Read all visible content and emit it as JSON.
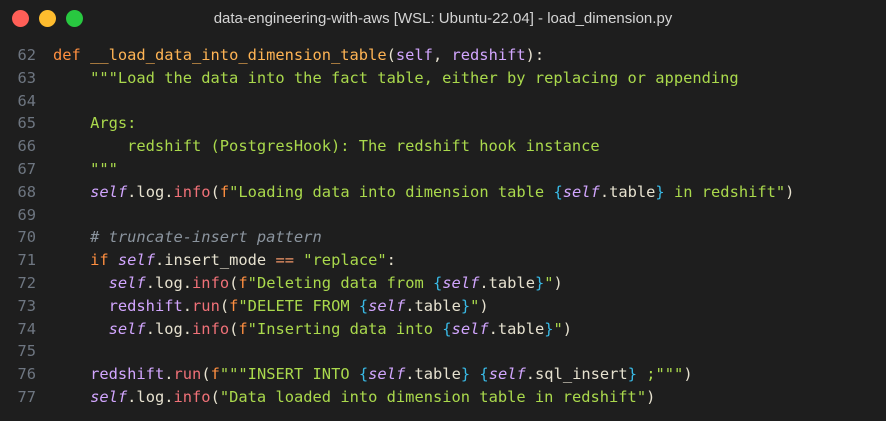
{
  "window": {
    "title": "data-engineering-with-aws [WSL: Ubuntu-22.04] - load_dimension.py"
  },
  "editor": {
    "lines": [
      {
        "num": "62",
        "tokens": [
          {
            "t": "def ",
            "c": "kw"
          },
          {
            "t": "__load_data_into_dimension_table",
            "c": "fn"
          },
          {
            "t": "(",
            "c": "plain"
          },
          {
            "t": "self",
            "c": "param"
          },
          {
            "t": ", ",
            "c": "plain"
          },
          {
            "t": "redshift",
            "c": "param"
          },
          {
            "t": "):",
            "c": "plain"
          }
        ]
      },
      {
        "num": "63",
        "tokens": [
          {
            "t": "    \"\"\"Load the data into the fact table, either by replacing or appending",
            "c": "str"
          }
        ]
      },
      {
        "num": "64",
        "tokens": []
      },
      {
        "num": "65",
        "tokens": [
          {
            "t": "    Args:",
            "c": "str"
          }
        ]
      },
      {
        "num": "66",
        "tokens": [
          {
            "t": "        redshift (PostgresHook): The redshift hook instance",
            "c": "str"
          }
        ]
      },
      {
        "num": "67",
        "tokens": [
          {
            "t": "    \"\"\"",
            "c": "str"
          }
        ]
      },
      {
        "num": "68",
        "tokens": [
          {
            "t": "    ",
            "c": "plain"
          },
          {
            "t": "self",
            "c": "self"
          },
          {
            "t": ".log.",
            "c": "plain"
          },
          {
            "t": "info",
            "c": "call"
          },
          {
            "t": "(",
            "c": "plain"
          },
          {
            "t": "f",
            "c": "kw"
          },
          {
            "t": "\"Loading data into dimension table ",
            "c": "str"
          },
          {
            "t": "{",
            "c": "brace"
          },
          {
            "t": "self",
            "c": "self"
          },
          {
            "t": ".table",
            "c": "plain"
          },
          {
            "t": "}",
            "c": "brace"
          },
          {
            "t": " in redshift\"",
            "c": "str"
          },
          {
            "t": ")",
            "c": "plain"
          }
        ]
      },
      {
        "num": "69",
        "tokens": []
      },
      {
        "num": "70",
        "tokens": [
          {
            "t": "    # truncate-insert pattern",
            "c": "cmt"
          }
        ]
      },
      {
        "num": "71",
        "tokens": [
          {
            "t": "    ",
            "c": "plain"
          },
          {
            "t": "if ",
            "c": "kw"
          },
          {
            "t": "self",
            "c": "self"
          },
          {
            "t": ".insert_mode ",
            "c": "plain"
          },
          {
            "t": "==",
            "c": "op"
          },
          {
            "t": " ",
            "c": "plain"
          },
          {
            "t": "\"replace\"",
            "c": "str"
          },
          {
            "t": ":",
            "c": "plain"
          }
        ]
      },
      {
        "num": "72",
        "tokens": [
          {
            "t": "      ",
            "c": "plain"
          },
          {
            "t": "self",
            "c": "self"
          },
          {
            "t": ".log.",
            "c": "plain"
          },
          {
            "t": "info",
            "c": "call"
          },
          {
            "t": "(",
            "c": "plain"
          },
          {
            "t": "f",
            "c": "kw"
          },
          {
            "t": "\"Deleting data from ",
            "c": "str"
          },
          {
            "t": "{",
            "c": "brace"
          },
          {
            "t": "self",
            "c": "self"
          },
          {
            "t": ".table",
            "c": "plain"
          },
          {
            "t": "}",
            "c": "brace"
          },
          {
            "t": "\"",
            "c": "str"
          },
          {
            "t": ")",
            "c": "plain"
          }
        ]
      },
      {
        "num": "73",
        "tokens": [
          {
            "t": "      ",
            "c": "plain"
          },
          {
            "t": "redshift",
            "c": "param"
          },
          {
            "t": ".",
            "c": "plain"
          },
          {
            "t": "run",
            "c": "call"
          },
          {
            "t": "(",
            "c": "plain"
          },
          {
            "t": "f",
            "c": "kw"
          },
          {
            "t": "\"DELETE FROM ",
            "c": "str"
          },
          {
            "t": "{",
            "c": "brace"
          },
          {
            "t": "self",
            "c": "self"
          },
          {
            "t": ".table",
            "c": "plain"
          },
          {
            "t": "}",
            "c": "brace"
          },
          {
            "t": "\"",
            "c": "str"
          },
          {
            "t": ")",
            "c": "plain"
          }
        ]
      },
      {
        "num": "74",
        "tokens": [
          {
            "t": "      ",
            "c": "plain"
          },
          {
            "t": "self",
            "c": "self"
          },
          {
            "t": ".log.",
            "c": "plain"
          },
          {
            "t": "info",
            "c": "call"
          },
          {
            "t": "(",
            "c": "plain"
          },
          {
            "t": "f",
            "c": "kw"
          },
          {
            "t": "\"Inserting data into ",
            "c": "str"
          },
          {
            "t": "{",
            "c": "brace"
          },
          {
            "t": "self",
            "c": "self"
          },
          {
            "t": ".table",
            "c": "plain"
          },
          {
            "t": "}",
            "c": "brace"
          },
          {
            "t": "\"",
            "c": "str"
          },
          {
            "t": ")",
            "c": "plain"
          }
        ]
      },
      {
        "num": "75",
        "tokens": []
      },
      {
        "num": "76",
        "tokens": [
          {
            "t": "    ",
            "c": "plain"
          },
          {
            "t": "redshift",
            "c": "param"
          },
          {
            "t": ".",
            "c": "plain"
          },
          {
            "t": "run",
            "c": "call"
          },
          {
            "t": "(",
            "c": "plain"
          },
          {
            "t": "f",
            "c": "kw"
          },
          {
            "t": "\"\"\"INSERT INTO ",
            "c": "str"
          },
          {
            "t": "{",
            "c": "brace"
          },
          {
            "t": "self",
            "c": "self"
          },
          {
            "t": ".table",
            "c": "plain"
          },
          {
            "t": "}",
            "c": "brace"
          },
          {
            "t": " ",
            "c": "str"
          },
          {
            "t": "{",
            "c": "brace"
          },
          {
            "t": "self",
            "c": "self"
          },
          {
            "t": ".sql_insert",
            "c": "plain"
          },
          {
            "t": "}",
            "c": "brace"
          },
          {
            "t": " ;\"\"\"",
            "c": "str"
          },
          {
            "t": ")",
            "c": "plain"
          }
        ]
      },
      {
        "num": "77",
        "tokens": [
          {
            "t": "    ",
            "c": "plain"
          },
          {
            "t": "self",
            "c": "self"
          },
          {
            "t": ".log.",
            "c": "plain"
          },
          {
            "t": "info",
            "c": "call"
          },
          {
            "t": "(",
            "c": "plain"
          },
          {
            "t": "\"Data loaded into dimension table in redshift\"",
            "c": "str"
          },
          {
            "t": ")",
            "c": "plain"
          }
        ]
      }
    ]
  },
  "colors": {
    "background": "#1e1e1e",
    "keyword": "#ff8f40",
    "function": "#ffb454",
    "string": "#aad94c",
    "self": "#d2a6ff",
    "call": "#f07178",
    "comment": "#8b949e",
    "brace": "#39bae6"
  }
}
